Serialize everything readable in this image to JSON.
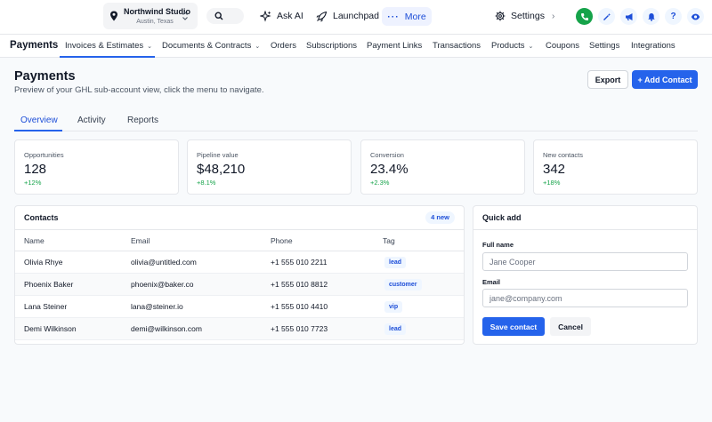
{
  "colors": {
    "accent": "#2563eb",
    "positive": "#16a34a",
    "phone": "#16a34a"
  },
  "location": {
    "name": "Northwind Studio",
    "subtitle": "Austin, Texas",
    "icon": "map-pin-icon"
  },
  "topbar": {
    "ask_ai": "Ask AI",
    "launchpad": "Launchpad",
    "more": "More",
    "settings": "Settings",
    "icons": [
      "search-icon",
      "sparkle-icon",
      "rocket-icon",
      "phone-icon",
      "magic-wand-icon",
      "megaphone-icon",
      "bell-icon",
      "help-icon",
      "eye-icon"
    ],
    "help_glyph": "?"
  },
  "nav": {
    "brand": "Payments",
    "items": [
      {
        "label": "Invoices & Estimates",
        "dropdown": true,
        "active": true
      },
      {
        "label": "Documents & Contracts",
        "dropdown": true
      },
      {
        "label": "Orders"
      },
      {
        "label": "Subscriptions"
      },
      {
        "label": "Payment Links"
      },
      {
        "label": "Transactions"
      },
      {
        "label": "Products",
        "dropdown": true
      },
      {
        "label": "Coupons"
      },
      {
        "label": "Settings"
      },
      {
        "label": "Integrations"
      }
    ],
    "caret": "⌄"
  },
  "header": {
    "title": "Payments",
    "subtitle": "Preview of your GHL sub-account view, click the menu to navigate.",
    "export_label": "Export",
    "add_label": "+ Add Contact"
  },
  "tabs": [
    {
      "label": "Overview",
      "active": true
    },
    {
      "label": "Activity"
    },
    {
      "label": "Reports"
    }
  ],
  "stats": [
    {
      "label": "Opportunities",
      "value": "128",
      "delta": "+12%"
    },
    {
      "label": "Pipeline value",
      "value": "$48,210",
      "delta": "+8.1%"
    },
    {
      "label": "Conversion",
      "value": "23.4%",
      "delta": "+2.3%"
    },
    {
      "label": "New contacts",
      "value": "342",
      "delta": "+18%"
    }
  ],
  "contacts": {
    "title": "Contacts",
    "badge": "4 new",
    "columns": [
      "Name",
      "Email",
      "Phone",
      "Tag"
    ],
    "rows": [
      {
        "name": "Olivia Rhye",
        "email": "olivia@untitled.com",
        "phone": "+1 555 010 2211",
        "tag": "lead"
      },
      {
        "name": "Phoenix Baker",
        "email": "phoenix@baker.co",
        "phone": "+1 555 010 8812",
        "tag": "customer"
      },
      {
        "name": "Lana Steiner",
        "email": "lana@steiner.io",
        "phone": "+1 555 010 4410",
        "tag": "vip"
      },
      {
        "name": "Demi Wilkinson",
        "email": "demi@wilkinson.com",
        "phone": "+1 555 010 7723",
        "tag": "lead"
      }
    ]
  },
  "quick_add": {
    "title": "Quick add",
    "full_name_label": "Full name",
    "full_name_placeholder": "Jane Cooper",
    "email_label": "Email",
    "email_placeholder": "jane@company.com",
    "save_label": "Save contact",
    "cancel_label": "Cancel"
  }
}
